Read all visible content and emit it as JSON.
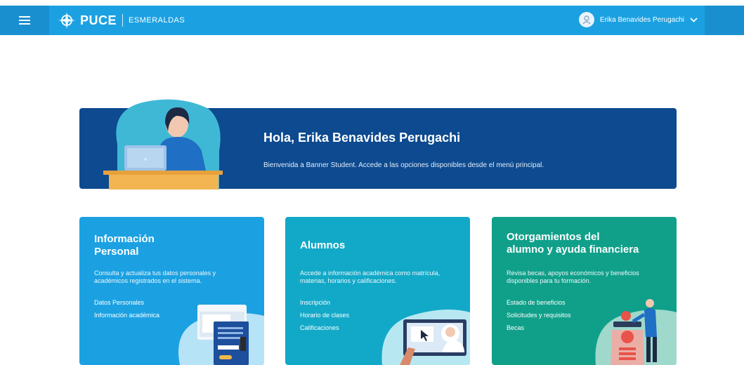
{
  "header": {
    "logo": "PUCE",
    "campus": "ESMERALDAS",
    "user_name": "Erika Benavides Perugachi"
  },
  "hero": {
    "title": "Hola, Erika Benavides Perugachi",
    "subtitle": "Bienvenida a Banner Student. Accede a las opciones disponibles desde el menú principal."
  },
  "cards": [
    {
      "title_line1": "Información",
      "title_line2": "Personal",
      "desc": "Consulta y actualiza tus datos personales y académicos registrados en el sistema.",
      "links": [
        "Datos Personales",
        "Información académica"
      ],
      "color": "#1ba1e2"
    },
    {
      "title_line1": "Alumnos",
      "desc": "Accede a información académica como matrícula, materias, horarios y calificaciones.",
      "links": [
        "Inscripción",
        "Horario de clases",
        "Calificaciones"
      ],
      "color": "#12a9c8"
    },
    {
      "title_line1": "Otorgamientos del",
      "title_line2": "alumno y ayuda financiera",
      "desc": "Revisa becas, apoyos económicos y beneficios disponibles para tu formación.",
      "links": [
        "Estado de beneficios",
        "Solicitudes y requisitos",
        "Becas"
      ],
      "color": "#10a08a"
    }
  ],
  "colors": {
    "topbar": "#1ba1e2",
    "hero": "#0d4a8f",
    "accent": "#1a8fd0"
  }
}
